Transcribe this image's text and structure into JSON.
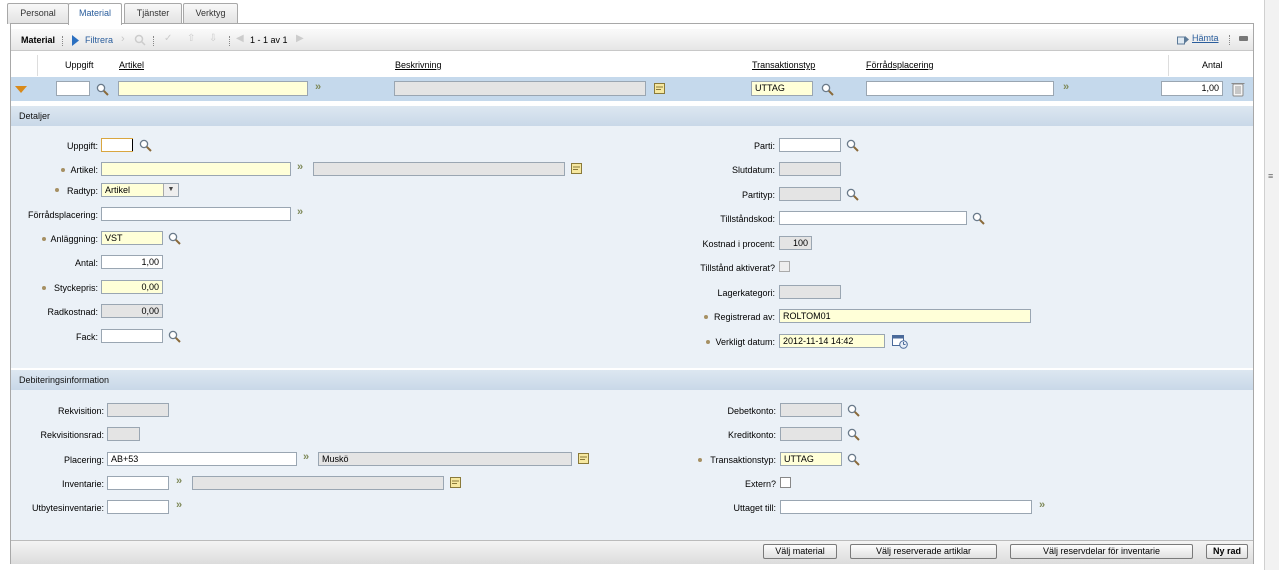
{
  "tabs": [
    "Personal",
    "Material",
    "Tjänster",
    "Verktyg"
  ],
  "toolbar": {
    "title": "Material",
    "filter": "Filtrera",
    "paging": "1 - 1 av 1",
    "fetch": "Hämta"
  },
  "columns": {
    "uppgift": "Uppgift",
    "artikel": "Artikel",
    "beskrivning": "Beskrivning",
    "transaktionstyp": "Transaktionstyp",
    "forradsplacering": "Förrådsplacering",
    "antal": "Antal"
  },
  "row": {
    "uppgift": "",
    "artikel": "",
    "beskrivning": "",
    "transaktionstyp": "UTTAG",
    "forradsplacering": "",
    "antal": "1,00"
  },
  "details": {
    "section_title": "Detaljer",
    "labels": {
      "uppgift": "Uppgift:",
      "artikel": "Artikel:",
      "radtyp": "Radtyp:",
      "forradsplacering": "Förrådsplacering:",
      "anlaggning": "Anläggning:",
      "antal": "Antal:",
      "styckepris": "Styckepris:",
      "radkostnad": "Radkostnad:",
      "fack": "Fack:",
      "parti": "Parti:",
      "slutdatum": "Slutdatum:",
      "partityp": "Partityp:",
      "tillstandskod": "Tillståndskod:",
      "kostnad_procent": "Kostnad i procent:",
      "tillstand_aktiverat": "Tillstånd aktiverat?",
      "lagerkategori": "Lagerkategori:",
      "registrerad_av": "Registrerad av:",
      "verkligt_datum": "Verkligt datum:"
    },
    "values": {
      "uppgift": "",
      "artikel": "",
      "artikel_desc": "",
      "radtyp": "Artikel",
      "forradsplacering": "",
      "anlaggning": "VST",
      "antal": "1,00",
      "styckepris": "0,00",
      "radkostnad": "0,00",
      "fack": "",
      "parti": "",
      "slutdatum": "",
      "partityp": "",
      "tillstandskod": "",
      "kostnad_procent": "100",
      "lagerkategori": "",
      "registrerad_av": "ROLTOM01",
      "verkligt_datum": "2012-11-14 14:42"
    }
  },
  "billing": {
    "section_title": "Debiteringsinformation",
    "labels": {
      "rekvisition": "Rekvisition:",
      "rekvisitionsrad": "Rekvisitionsrad:",
      "placering": "Placering:",
      "inventarie": "Inventarie:",
      "utbytesinventarie": "Utbytesinventarie:",
      "debetkonto": "Debetkonto:",
      "kreditkonto": "Kreditkonto:",
      "transaktionstyp": "Transaktionstyp:",
      "extern": "Extern?",
      "uttaget_till": "Uttaget till:"
    },
    "values": {
      "rekvisition": "",
      "rekvisitionsrad": "",
      "placering": "AB+53",
      "placering_desc": "Muskö",
      "inventarie": "",
      "inventarie_desc": "",
      "utbytesinventarie": "",
      "debetkonto": "",
      "kreditkonto": "",
      "transaktionstyp": "UTTAG",
      "uttaget_till": ""
    }
  },
  "buttons": {
    "valj_material": "Välj material",
    "valj_reserverade": "Välj reserverade artiklar",
    "valj_reservdelar": "Välj reservdelar för inventarie",
    "ny_rad": "Ny rad"
  },
  "colors": {
    "accent": "#2a5d9c",
    "required": "#a69063",
    "row_highlight": "#c5d9ec",
    "required_field": "#ffffd8"
  }
}
